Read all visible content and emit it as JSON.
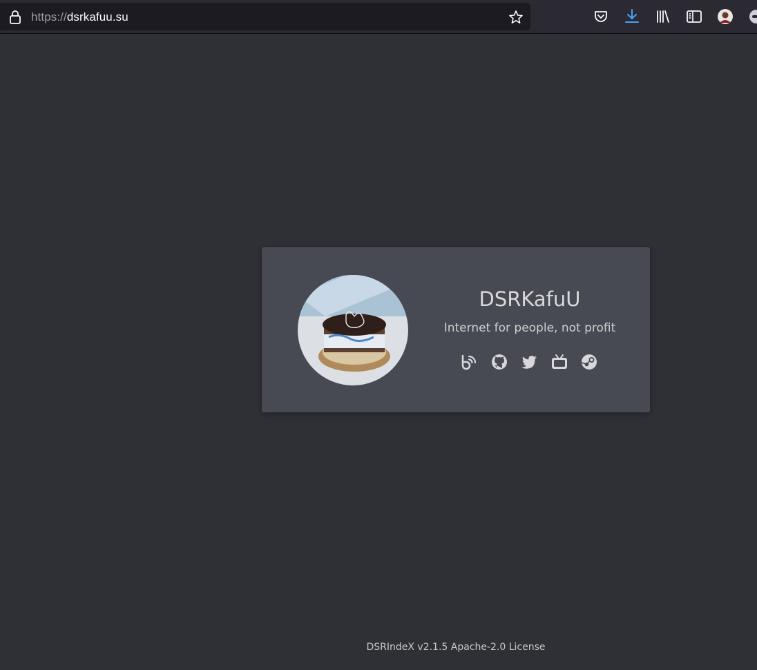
{
  "browser": {
    "url_scheme": "https://",
    "url_host": "dsrkafuu.su",
    "icons": [
      "lock-icon",
      "bookmark-star-icon",
      "pocket-icon",
      "downloads-icon",
      "library-icon",
      "sidebar-icon",
      "account-avatar",
      "extension-icon"
    ],
    "accent_color": "#45a1ff"
  },
  "profile": {
    "name": "DSRKafuU",
    "tagline": "Internet for people, not profit",
    "links": [
      {
        "icon": "blog-icon"
      },
      {
        "icon": "github-icon"
      },
      {
        "icon": "twitter-icon"
      },
      {
        "icon": "bilibili-tv-icon"
      },
      {
        "icon": "steam-icon"
      }
    ]
  },
  "footer": {
    "text": "DSRIndeX v2.1.5 Apache-2.0 License"
  },
  "colors": {
    "page_bg": "#2f3036",
    "card_bg": "#474a52",
    "text": "#d8d8d8"
  }
}
